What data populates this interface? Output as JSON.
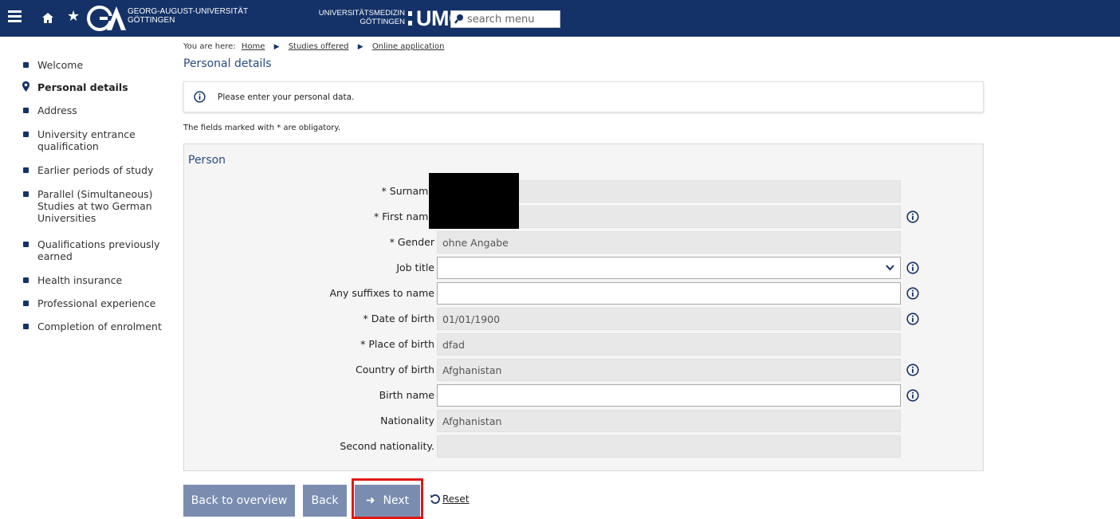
{
  "header": {
    "university_line1": "GEORG-AUGUST-UNIVERSITÄT",
    "university_line2": "GÖTTINGEN",
    "umg_line1": "UNIVERSITÄTSMEDIZIN",
    "umg_line2": "GÖTTINGEN",
    "umg_logo": "UMG",
    "search_placeholder": "search menu",
    "icons": [
      "menu-icon",
      "home-icon",
      "star-icon",
      "search-icon"
    ]
  },
  "breadcrumb": {
    "prefix": "You are here:",
    "items": [
      "Home",
      "Studies offered",
      "Online application"
    ]
  },
  "page_title": "Personal details",
  "sidebar": {
    "items": [
      {
        "label": "Welcome"
      },
      {
        "label": "Personal details"
      },
      {
        "label": "Address"
      },
      {
        "label": "University entrance qualification"
      },
      {
        "label": "Earlier periods of study"
      },
      {
        "label": "Parallel (Simultaneous) Studies at two German Universities"
      },
      {
        "label": "Qualifications previously earned"
      },
      {
        "label": "Health insurance"
      },
      {
        "label": "Professional experience"
      },
      {
        "label": "Completion of enrolment"
      }
    ]
  },
  "info_message": "Please enter your personal data.",
  "obligatory_note": "The fields marked with * are obligatory.",
  "form": {
    "legend": "Person",
    "fields": [
      {
        "label": "* Surname",
        "value": ""
      },
      {
        "label": "* First name",
        "value": ""
      },
      {
        "label": "* Gender",
        "value": "ohne Angabe"
      },
      {
        "label": "Job title",
        "value": ""
      },
      {
        "label": "Any suffixes to name",
        "value": ""
      },
      {
        "label": "* Date of birth",
        "value": "01/01/1900"
      },
      {
        "label": "* Place of birth",
        "value": "dfad"
      },
      {
        "label": "Country of birth",
        "value": "Afghanistan"
      },
      {
        "label": "Birth name",
        "value": ""
      },
      {
        "label": "Nationality",
        "value": "Afghanistan"
      },
      {
        "label": "Second nationality.",
        "value": ""
      }
    ]
  },
  "buttons": {
    "back_to_overview": "Back to overview",
    "back": "Back",
    "next": "Next",
    "reset": "Reset"
  },
  "colors": {
    "header_bg": "#153268",
    "button_bg": "#7a8db0",
    "highlight": "#e01818",
    "title": "#2a4a80"
  }
}
